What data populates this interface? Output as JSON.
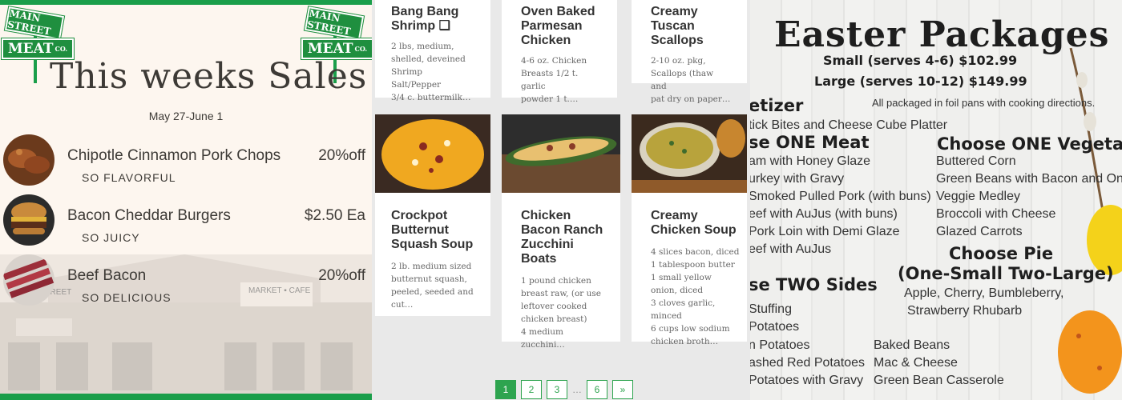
{
  "left": {
    "logo": {
      "line1": "MAIN STREET",
      "line2": "MEAT",
      "co": "CO."
    },
    "title": "This weeks Sales",
    "dates": "May 27-June 1",
    "sales": [
      {
        "name": "Chipotle Cinnamon Pork Chops",
        "tag": "SO FLAVORFUL",
        "price": "20%off"
      },
      {
        "name": "Bacon Cheddar Burgers",
        "tag": "SO JUICY",
        "price": "$2.50 Ea"
      },
      {
        "name": "Beef Bacon",
        "tag": "SO DELICIOUS",
        "price": "20%off"
      }
    ],
    "storefront": {
      "sign1": "MAIN STREET",
      "sign2": "MARKET ▪ CAFE"
    }
  },
  "middle": {
    "cards": [
      {
        "title": "Bang Bang Shrimp ❑",
        "desc": "2 lbs, medium,\nshelled, deveined\nShrimp Salt/Pepper\n3/4 c. buttermilk…"
      },
      {
        "title": "Oven Baked Parmesan Chicken",
        "desc": "4-6 oz. Chicken\nBreasts 1/2 t. garlic\npowder 1 t.…"
      },
      {
        "title": "Creamy Tuscan Scallops",
        "desc": "2-10 oz. pkg,\nScallops (thaw and\npat dry on paper…"
      },
      {
        "title": "Crockpot Butternut Squash Soup",
        "desc": "2 lb. medium sized\nbutternut squash,\npeeled, seeded and\ncut…"
      },
      {
        "title": "Chicken Bacon Ranch Zucchini Boats",
        "desc": "1 pound chicken\nbreast raw, (or use\nleftover cooked\nchicken breast)\n4 medium\nzucchini…"
      },
      {
        "title": "Creamy Chicken Soup",
        "desc": "4 slices bacon, diced\n1 tablespoon butter\n1 small yellow\nonion, diced\n3 cloves garlic, minced\n6 cups low sodium\nchicken broth…"
      }
    ],
    "pagination": {
      "pages": [
        "1",
        "2",
        "3",
        "6"
      ],
      "ellipsis": "…",
      "next": "»",
      "active": "1"
    }
  },
  "right": {
    "title": "Easter Packages",
    "small": "Small (serves 4-6) $102.99",
    "large": "Large (serves 10-12) $149.99",
    "note": "All packaged in foil pans with cooking directions.",
    "appetizer_head": "etizer",
    "appetizer_item": "tick Bites and Cheese Cube Platter",
    "meat_head": "se ONE Meat",
    "meats": [
      "am with Honey Glaze",
      "urkey with Gravy",
      "Smoked Pulled Pork (with buns)",
      "eef with AuJus (with buns)",
      " Pork Loin with Demi Glaze",
      "eef with AuJus"
    ],
    "veg_head": "Choose ONE Vegetab",
    "vegs": [
      "Buttered Corn",
      "Green Beans with Bacon and On",
      "Veggie Medley",
      "Broccoli with Cheese",
      "Glazed Carrots"
    ],
    "pie_head1": "Choose Pie",
    "pie_head2": "(One-Small Two-Large)",
    "pies1": "Apple, Cherry, Bumbleberry,",
    "pies2": "Strawberry Rhubarb",
    "sides_head": "se TWO Sides",
    "sides_left": [
      "Stuffing",
      "Potatoes",
      "n Potatoes",
      "ashed Red Potatoes",
      "Potatoes with Gravy"
    ],
    "sides_right": [
      "Baked Beans",
      "Mac & Cheese",
      "Green Bean Casserole"
    ]
  },
  "colors": {
    "green": "#1a9e4a",
    "pager_green": "#2ea44f",
    "text_dark": "#3d3a36"
  }
}
